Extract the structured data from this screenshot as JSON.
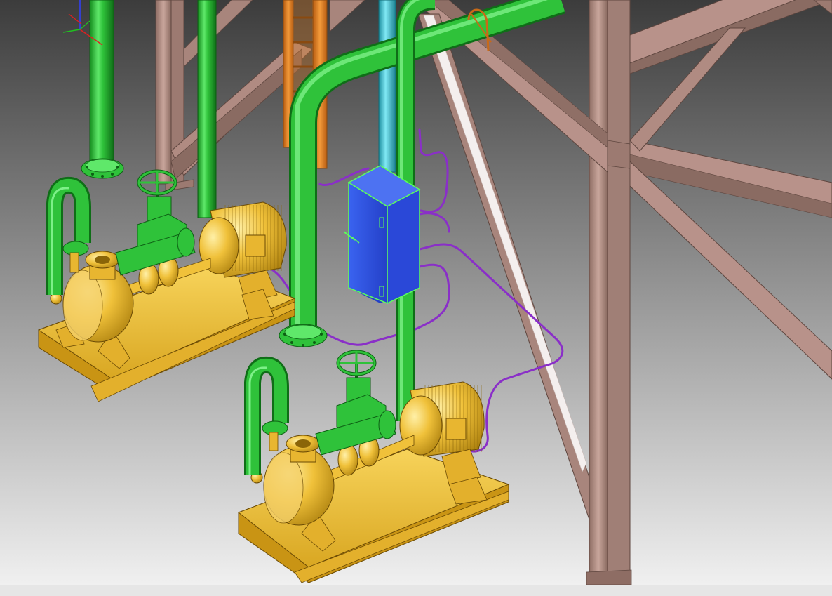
{
  "viewport": {
    "background_top": "#3c3c3c",
    "background_bottom": "#f0f0f0"
  },
  "colors": {
    "green_pipe": "#2fc23a",
    "green_dark": "#178a1f",
    "yellow_equipment": "#f0c13a",
    "yellow_dark": "#b58a12",
    "steel": "#b8928a",
    "steel_dark": "#7e6058",
    "orange_ladder": "#ee8a2a",
    "cyan_pipe": "#38c7d8",
    "blue_cabinet": "#2f55e6",
    "cabinet_highlight": "#5cff5c",
    "purple_conduit": "#8a2fc8"
  },
  "icons": {
    "axis_triad": "axis-triad-icon"
  },
  "statusbar": {
    "text": ""
  }
}
